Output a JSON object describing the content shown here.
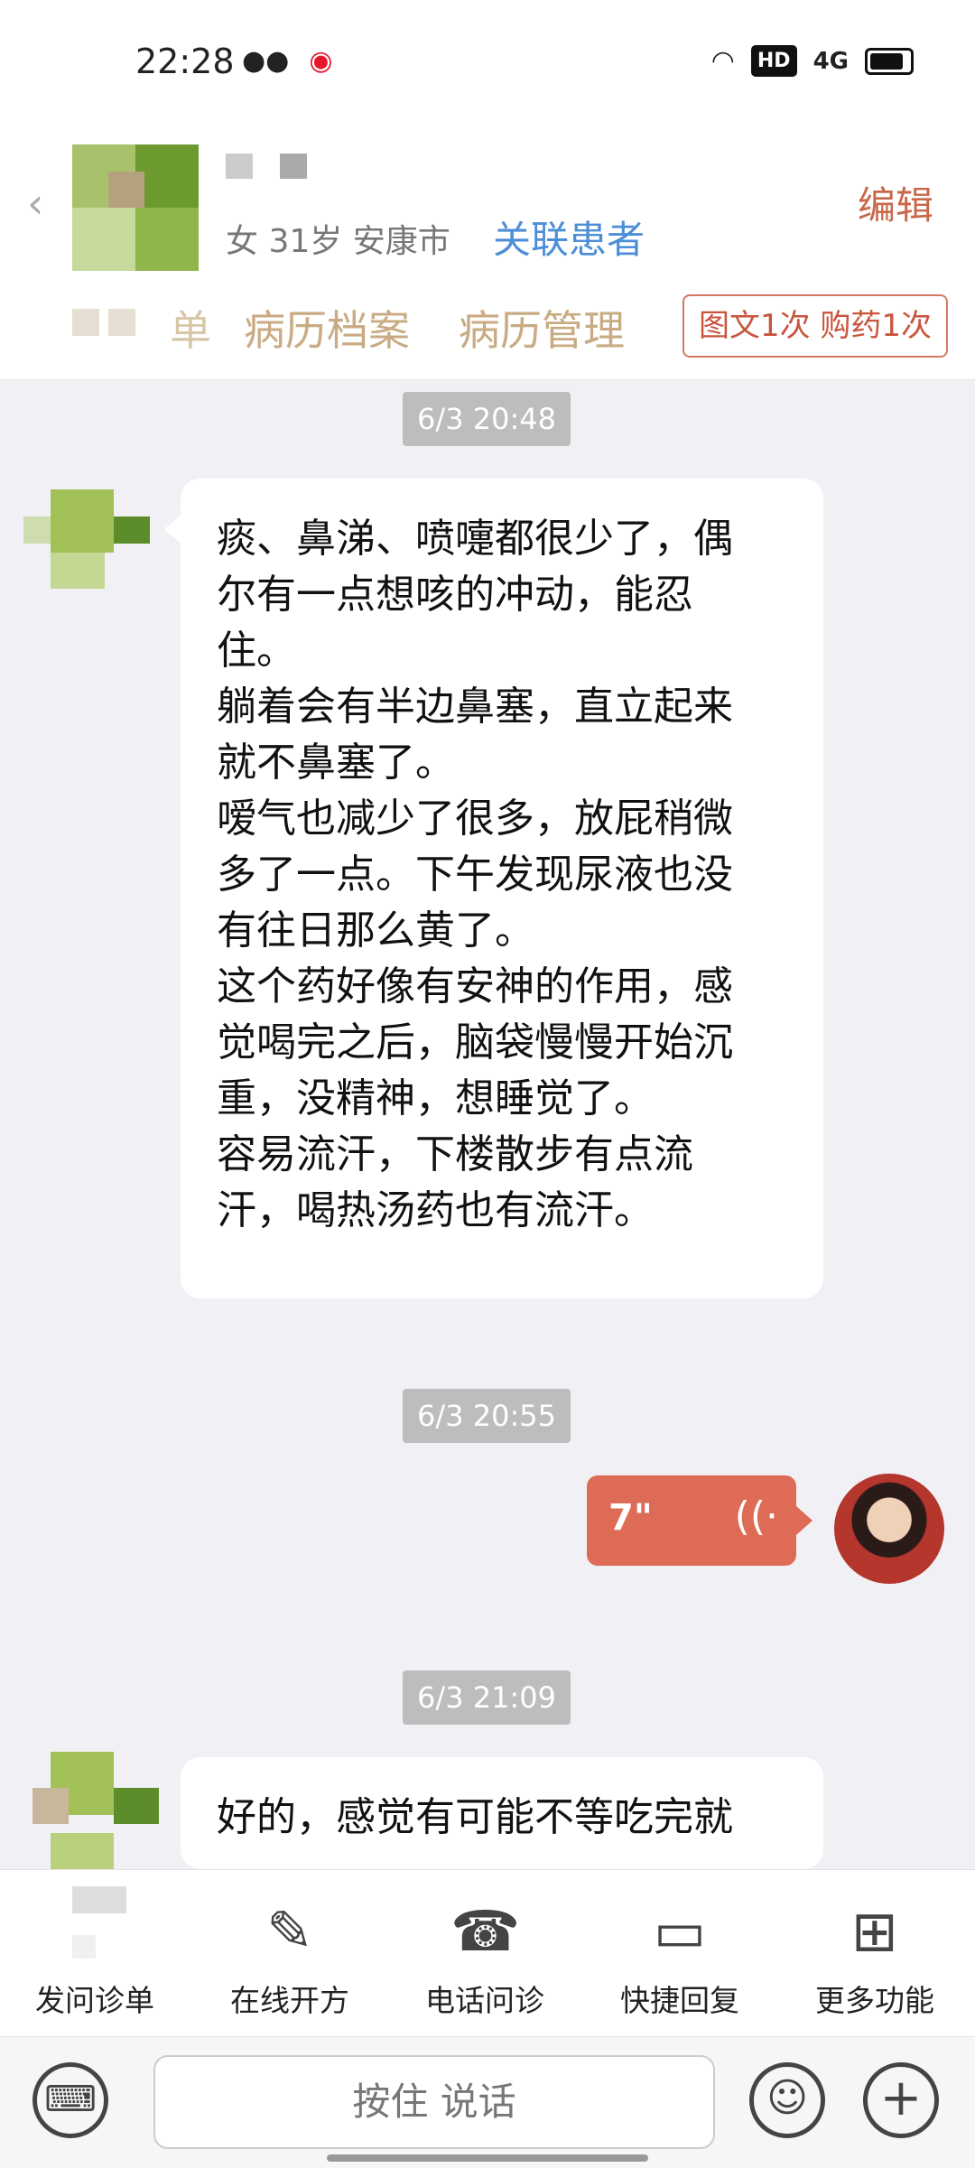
{
  "status_bar": {
    "time": "22:28",
    "hd": "HD",
    "network": "4G"
  },
  "patient": {
    "meta": "女 31岁  安康市",
    "link_label": "关联患者",
    "edit_label": "编辑"
  },
  "tabs": {
    "partial": "单",
    "items": [
      "病历档案",
      "病历管理"
    ]
  },
  "service_badge": "图文1次 购药1次",
  "messages": [
    {
      "time": "6/3 20:48",
      "lines": [
        "痰、鼻涕、喷嚏都很少了，偶",
        "尔有一点想咳的冲动，能忍",
        "住。",
        "躺着会有半边鼻塞，直立起来",
        "就不鼻塞了。",
        "嗳气也减少了很多，放屁稍微",
        "多了一点。下午发现尿液也没",
        "有往日那么黄了。",
        "这个药好像有安神的作用，感",
        "觉喝完之后，脑袋慢慢开始沉",
        "重，没精神，想睡觉了。",
        "容易流汗，下楼散步有点流",
        "汗，喝热汤药也有流汗。"
      ]
    },
    {
      "time": "6/3 20:55",
      "voice_duration": "7\""
    },
    {
      "time": "6/3 21:09",
      "lines": [
        "好的，感觉有可能不等吃完就"
      ]
    }
  ],
  "toolbar": {
    "items": [
      "发问诊单",
      "在线开方",
      "电话问诊",
      "快捷回复",
      "更多功能"
    ]
  },
  "input": {
    "hold_to_talk": "按住 说话"
  },
  "colors": {
    "accent": "#dd6b55",
    "link": "#4d8ed8",
    "tab": "#c9ab83"
  }
}
